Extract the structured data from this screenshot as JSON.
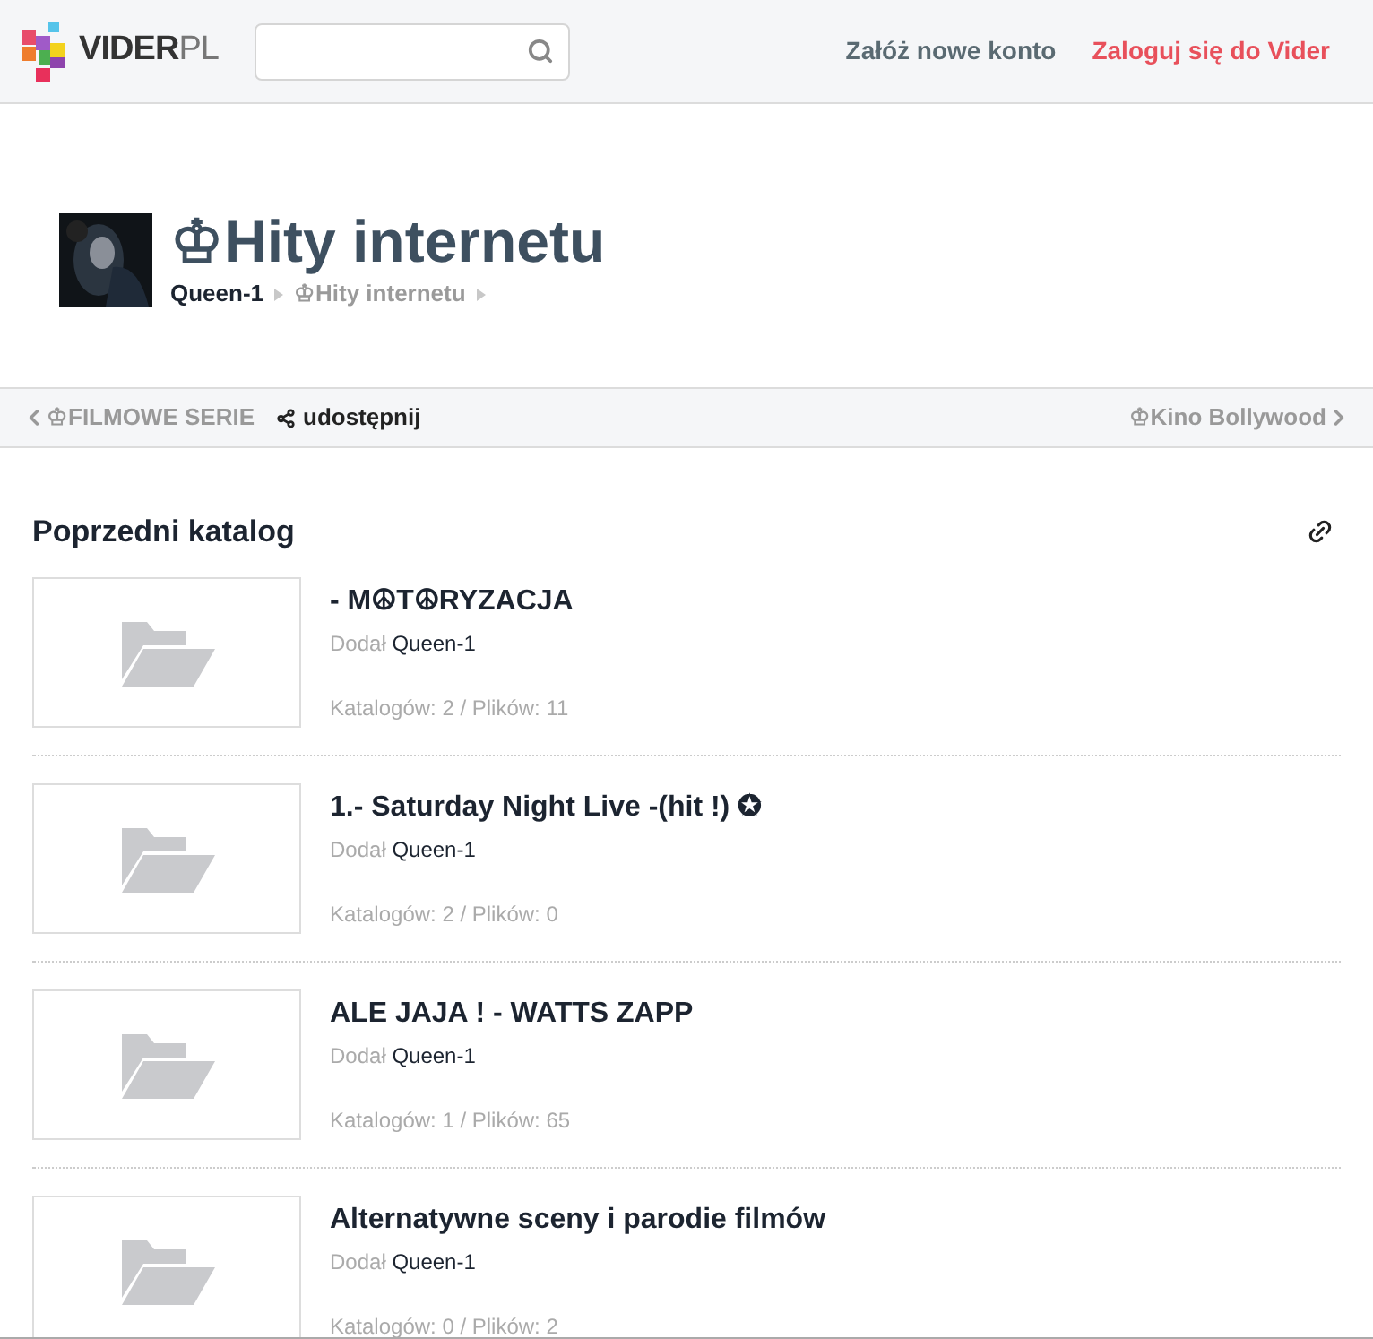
{
  "header": {
    "logo": {
      "main": "VIDER",
      "suffix": "PL"
    },
    "links": [
      {
        "label": "Załóż nowe konto",
        "kind": "register"
      },
      {
        "label": "Zaloguj się do Vider",
        "kind": "login"
      }
    ]
  },
  "title": {
    "text": "♔Hity internetu",
    "breadcrumbs": [
      {
        "label": "Queen-1",
        "kind": "user"
      },
      {
        "label": "♔Hity internetu",
        "kind": "folder"
      }
    ]
  },
  "nav": {
    "prev": "♔FILMOWE SERIE",
    "share": "udostępnij",
    "next": "♔Kino Bollywood"
  },
  "section": {
    "title": "Poprzedni katalog"
  },
  "folders": [
    {
      "title": "- M☮T☮RYZACJA",
      "added_label": "Dodał",
      "author": "Queen-1",
      "stats": "Katalogów: 2 / Plików: 11"
    },
    {
      "title": "1.- Saturday Night Live -(hit !) ✪",
      "added_label": "Dodał",
      "author": "Queen-1",
      "stats": "Katalogów: 2 / Plików: 0"
    },
    {
      "title": "ALE JAJA ! - WATTS ZAPP",
      "added_label": "Dodał",
      "author": "Queen-1",
      "stats": "Katalogów: 1 / Plików: 65"
    },
    {
      "title": "Alternatywne sceny i parodie filmów",
      "added_label": "Dodał",
      "author": "Queen-1",
      "stats": "Katalogów: 0 / Plików: 2"
    }
  ]
}
